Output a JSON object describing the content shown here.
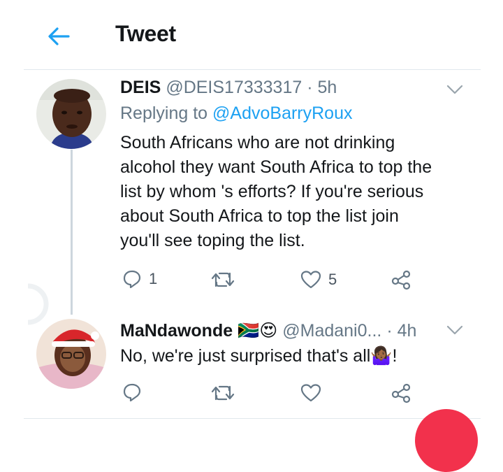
{
  "header": {
    "title": "Tweet"
  },
  "tweets": [
    {
      "name": "DEIS",
      "handle": "@DEIS17333317",
      "separator": "·",
      "time": "5h",
      "replying_prefix": "Replying to",
      "replying_to": "@AdvoBarryRoux",
      "text_lines": [
        "South Africans who are not drinking",
        "alcohol they want South Africa to top the",
        "list by whom 's efforts? If you're serious",
        "about South Africa to top the list join",
        "you'll see toping the list."
      ],
      "reply_count": "1",
      "retweet_count": "",
      "like_count": "5"
    },
    {
      "name": "MaNdawonde",
      "name_emoji": "🇿🇦😍",
      "handle": "@Madani0...",
      "separator": "·",
      "time": "4h",
      "text": "No, we're just surprised that's all",
      "text_emoji": "🤷🏾‍♀️",
      "text_end": "!",
      "reply_count": "",
      "retweet_count": "",
      "like_count": ""
    }
  ],
  "icons": {
    "back": "back-arrow-icon",
    "reply": "reply-icon",
    "retweet": "retweet-icon",
    "like": "heart-icon",
    "share": "share-icon",
    "caret": "chevron-down-icon"
  },
  "colors": {
    "accent": "#1da1f2",
    "muted": "#657786",
    "text": "#14171a",
    "fab": "#f2314c"
  }
}
